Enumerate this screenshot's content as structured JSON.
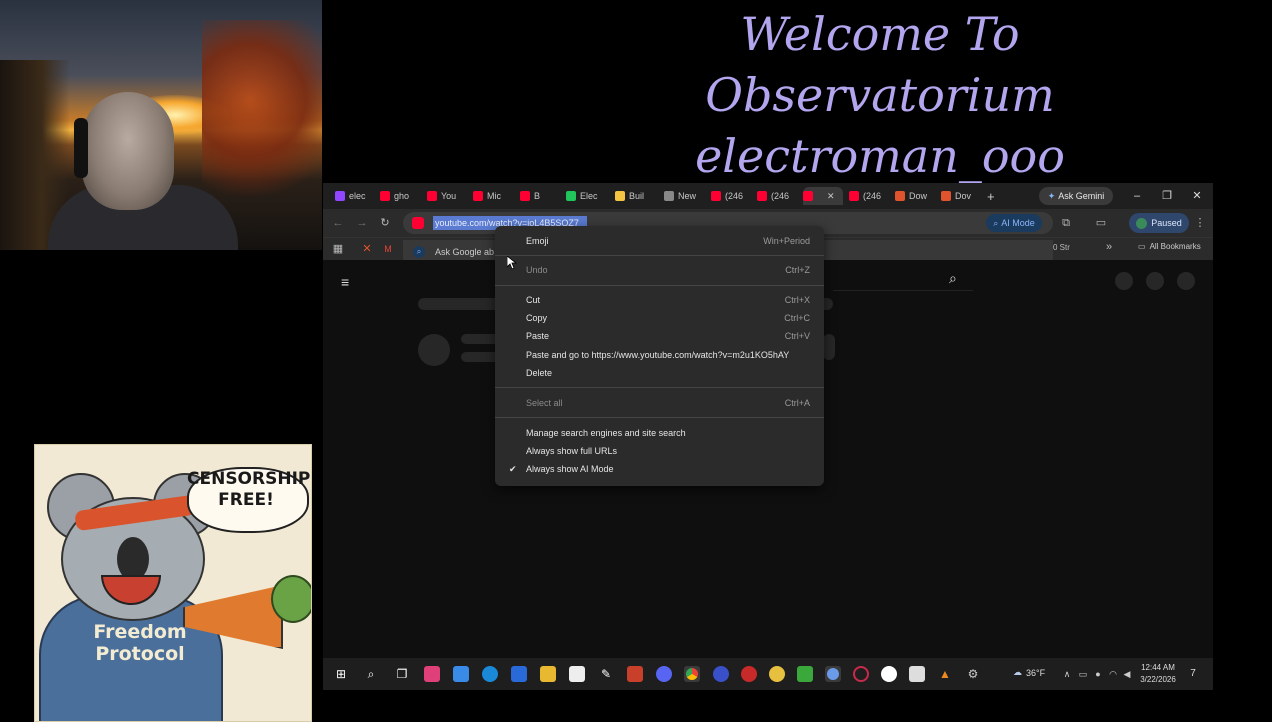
{
  "overlay": {
    "title_line1": "Welcome To Observatorium",
    "title_line2": "electroman_ooo"
  },
  "poster": {
    "bubble_text": "CENSORSHIP\nFREE!",
    "hoodie_text": "Freedom\nProtocol"
  },
  "browser": {
    "tabs": [
      {
        "label": "elec",
        "icon": "twitch-icon",
        "color": "#9146ff"
      },
      {
        "label": "gho",
        "icon": "youtube-icon",
        "color": "#ff0033"
      },
      {
        "label": "You",
        "icon": "youtube-icon",
        "color": "#ff0033"
      },
      {
        "label": "Mic",
        "icon": "youtube-icon",
        "color": "#ff0033"
      },
      {
        "label": "B",
        "icon": "youtube-icon",
        "color": "#ff0033"
      },
      {
        "label": "Elec",
        "icon": "x-green-icon",
        "color": "#21c45a"
      },
      {
        "label": "Buil",
        "icon": "emoji-icon",
        "color": "#f4c542"
      },
      {
        "label": "New",
        "icon": "globe-icon",
        "color": "#888888"
      },
      {
        "label": "(246",
        "icon": "youtube-icon",
        "color": "#ff0033"
      },
      {
        "label": "(246",
        "icon": "youtube-icon",
        "color": "#ff0033"
      },
      {
        "label": "",
        "icon": "youtube-icon",
        "color": "#ff0033"
      },
      {
        "label": "(246",
        "icon": "youtube-icon",
        "color": "#ff0033"
      },
      {
        "label": "Dow",
        "icon": "x-orange-icon",
        "color": "#e0542d"
      },
      {
        "label": "Dov",
        "icon": "x-orange-icon",
        "color": "#e0542d"
      }
    ],
    "ask_gemini": "Ask Gemini",
    "url_text": "youtube.com/watch?v=ioL4B5SQZ7",
    "ai_mode": "AI Mode",
    "profile_status": "Paused",
    "ask_google_text": "Ask Google ab",
    "bookmarks_more": "0 Str",
    "all_bookmarks": "All Bookmarks"
  },
  "context_menu": {
    "items": [
      {
        "label": "Emoji",
        "shortcut": "Win+Period",
        "disabled": false
      },
      {
        "label": "Undo",
        "shortcut": "Ctrl+Z",
        "disabled": true
      },
      {
        "label": "Cut",
        "shortcut": "Ctrl+X",
        "disabled": false
      },
      {
        "label": "Copy",
        "shortcut": "Ctrl+C",
        "disabled": false
      },
      {
        "label": "Paste",
        "shortcut": "Ctrl+V",
        "disabled": false
      },
      {
        "label": "Paste and go to https://www.youtube.com/watch?v=m2u1KO5hAY",
        "shortcut": "",
        "disabled": false
      },
      {
        "label": "Delete",
        "shortcut": "",
        "disabled": false
      },
      {
        "label": "Select all",
        "shortcut": "Ctrl+A",
        "disabled": true
      },
      {
        "label": "Manage search engines and site search",
        "shortcut": "",
        "disabled": false
      },
      {
        "label": "Always show full URLs",
        "shortcut": "",
        "disabled": false
      },
      {
        "label": "Always show AI Mode",
        "shortcut": "",
        "disabled": false,
        "checked": true
      }
    ]
  },
  "taskbar": {
    "weather": "36°F",
    "time": "12:44 AM",
    "date": "3/22/2026",
    "notification_count": "7"
  }
}
